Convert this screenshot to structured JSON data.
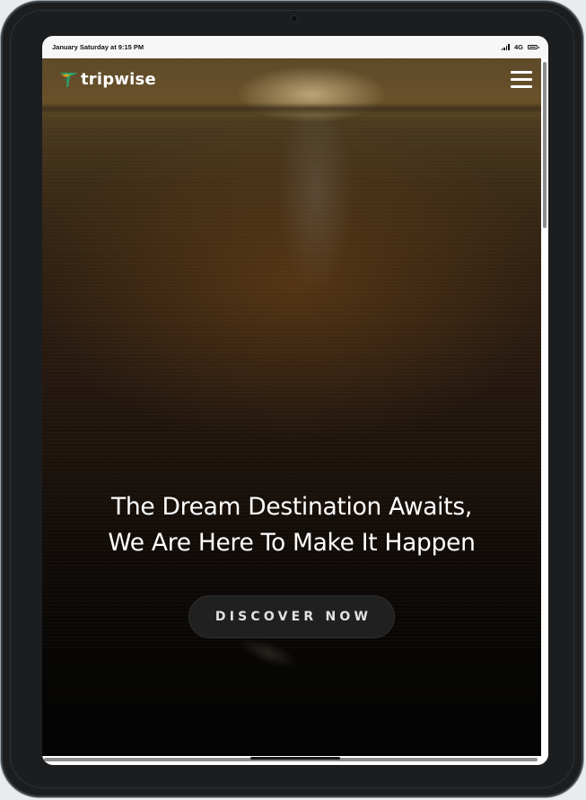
{
  "status_bar": {
    "datetime": "January Saturday at 9:15 PM",
    "network": "4G"
  },
  "navbar": {
    "brand": "tripwise",
    "logo_icon": "plane-logo-icon",
    "menu_icon": "hamburger-menu-icon"
  },
  "hero": {
    "headline_line1": "The Dream Destination Awaits,",
    "headline_line2": "We Are Here To Make It Happen",
    "cta_label": "DISCOVER NOW"
  },
  "colors": {
    "text": "#ffffff",
    "cta_background": "#202020",
    "cta_text": "#e2e2e2",
    "status_bar": "#f7f7f7",
    "logo_green": "#2aa36b"
  }
}
